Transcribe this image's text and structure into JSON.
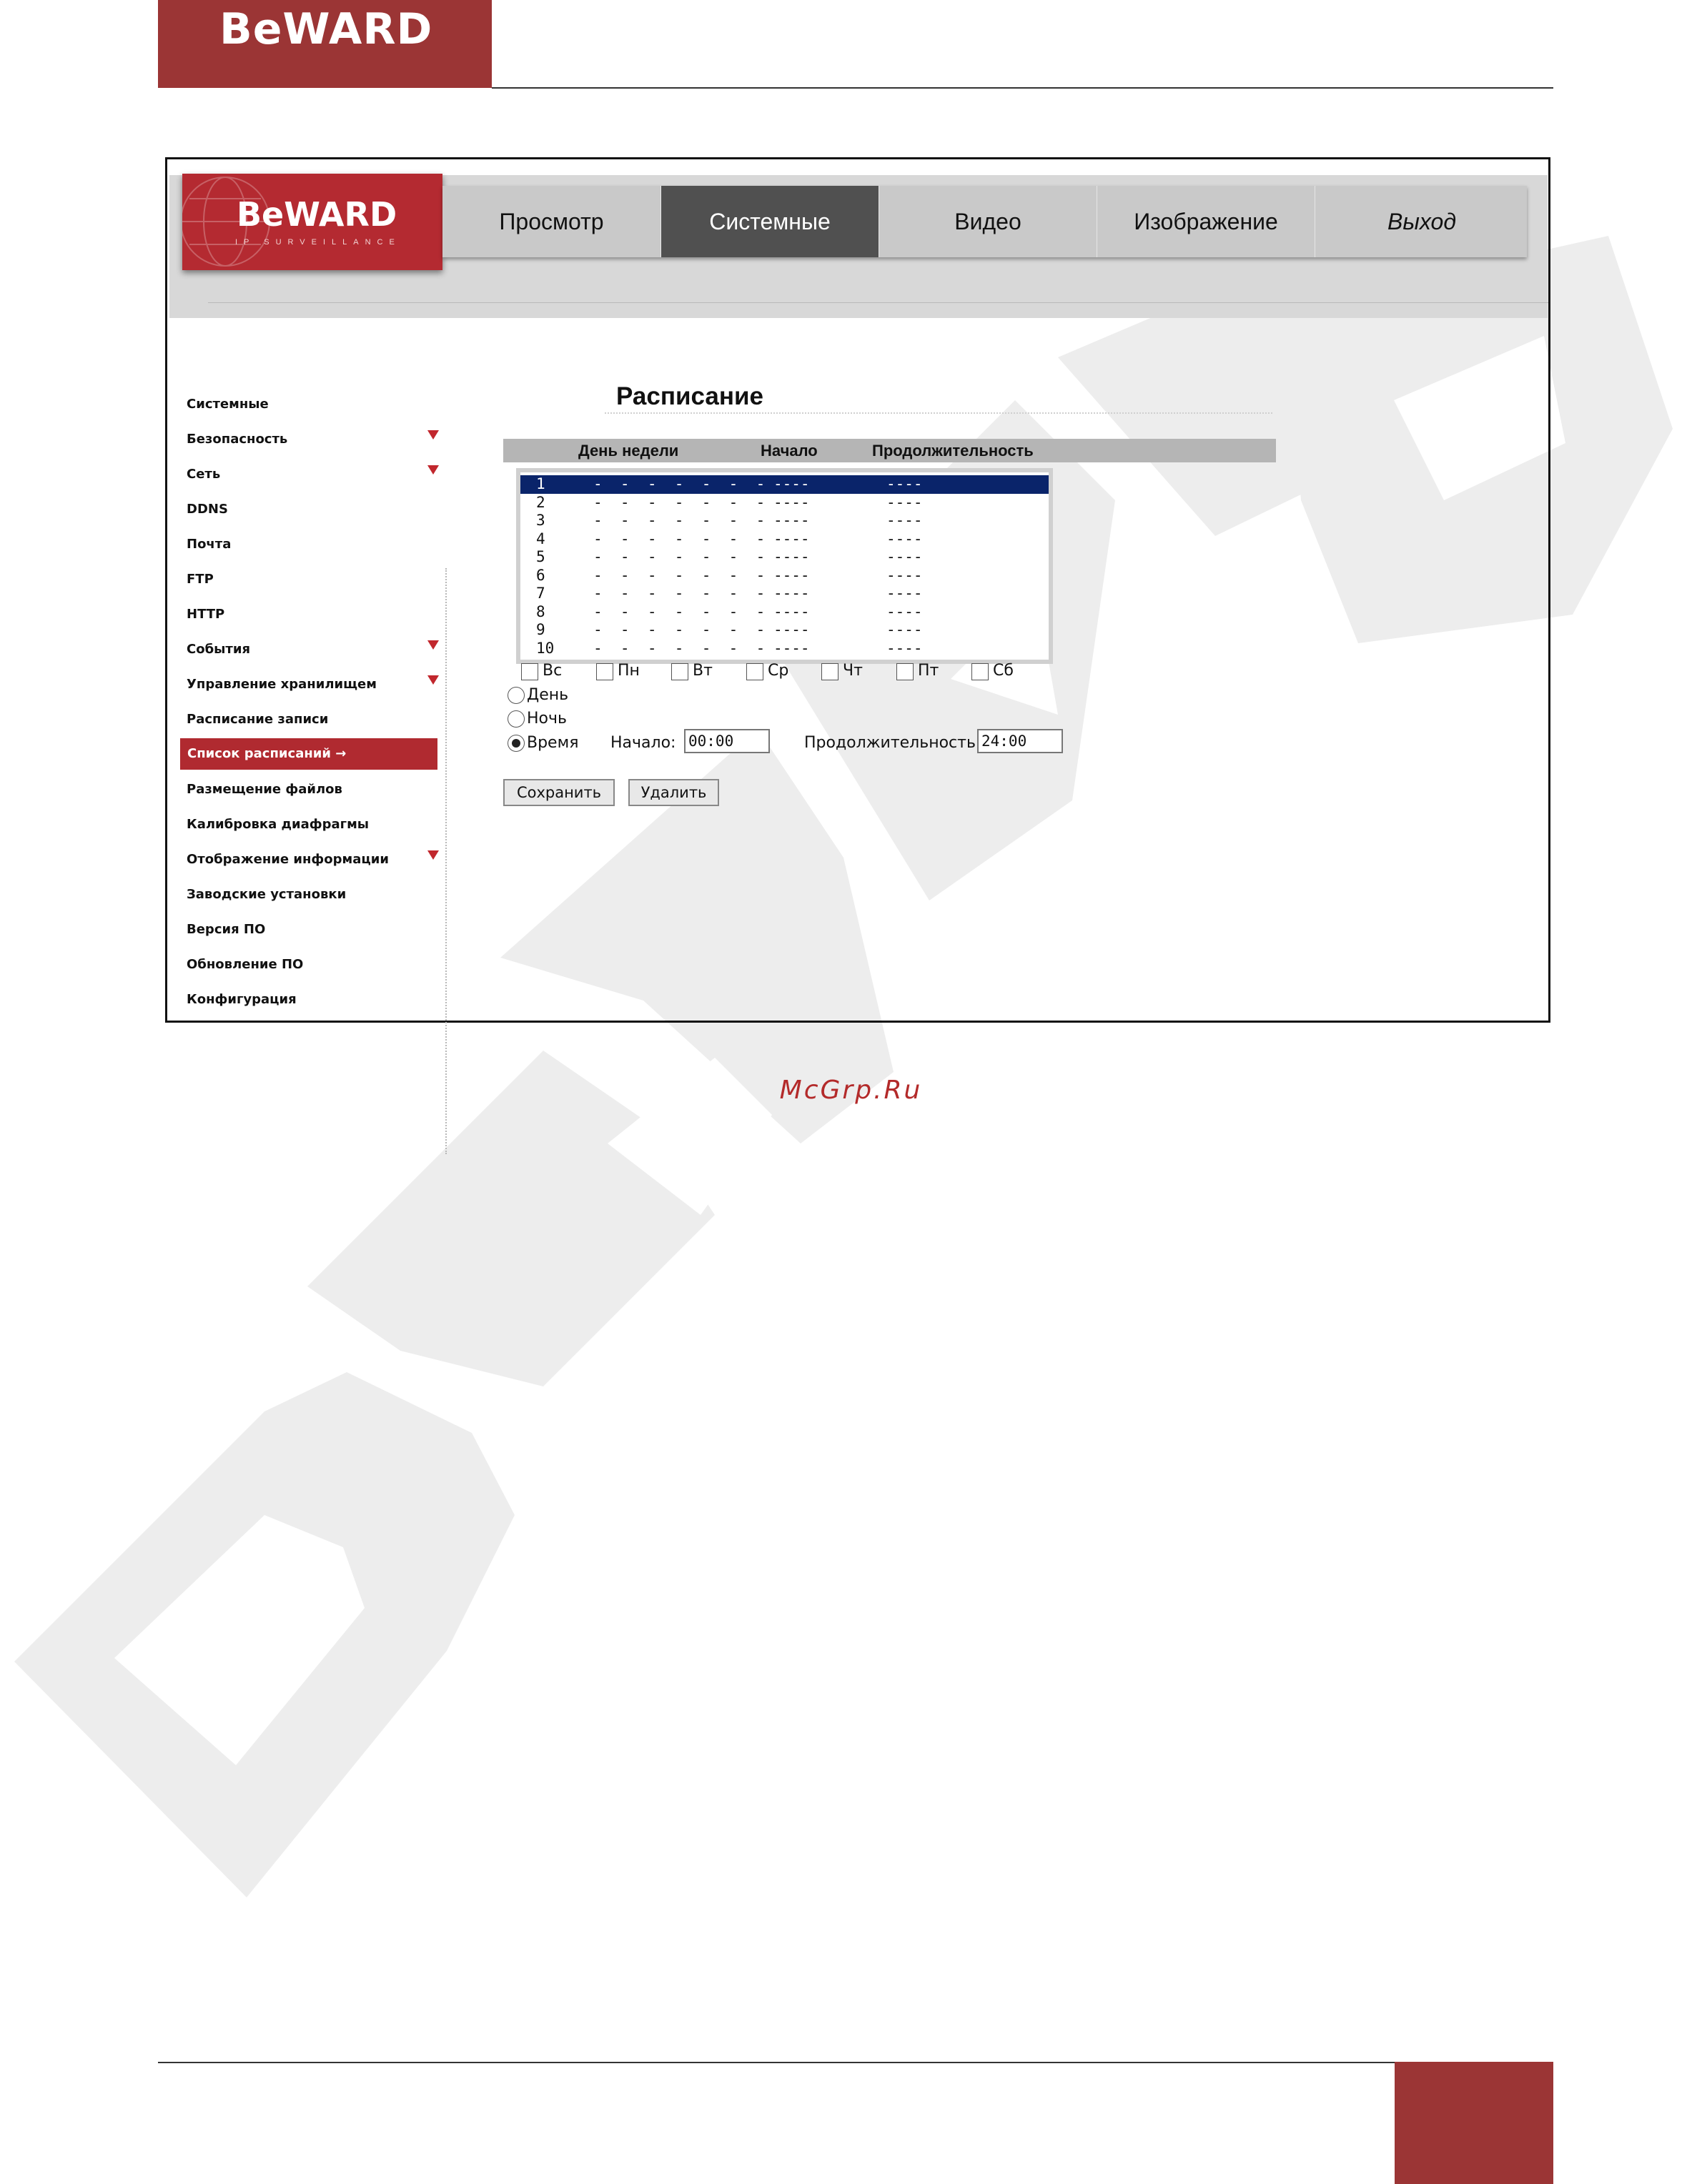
{
  "document": {
    "logo_text": "BeWARD",
    "footer_site": "McGrp.Ru"
  },
  "app": {
    "logo_text": "BeWARD",
    "logo_subtitle": "IP SURVEILLANCE",
    "nav": [
      {
        "label": "Просмотр",
        "active": false
      },
      {
        "label": "Системные",
        "active": true
      },
      {
        "label": "Видео",
        "active": false
      },
      {
        "label": "Изображение",
        "active": false
      },
      {
        "label": "Выход",
        "active": false
      }
    ]
  },
  "sidebar": {
    "items": [
      {
        "label": "Системные",
        "has_arrow": false
      },
      {
        "label": "Безопасность",
        "has_arrow": true
      },
      {
        "label": "Сеть",
        "has_arrow": true
      },
      {
        "label": "DDNS",
        "has_arrow": false
      },
      {
        "label": "Почта",
        "has_arrow": false
      },
      {
        "label": "FTP",
        "has_arrow": false
      },
      {
        "label": "HTTP",
        "has_arrow": false
      },
      {
        "label": "События",
        "has_arrow": true
      },
      {
        "label": "Управление хранилищем",
        "has_arrow": true
      },
      {
        "label": "Расписание записи",
        "has_arrow": false
      },
      {
        "label": "Список расписаний",
        "has_arrow": false,
        "active": true,
        "suffix": "→"
      },
      {
        "label": "Размещение файлов",
        "has_arrow": false
      },
      {
        "label": "Калибровка диафрагмы",
        "has_arrow": false
      },
      {
        "label": "Отображение информации",
        "has_arrow": true
      },
      {
        "label": "Заводские установки",
        "has_arrow": false
      },
      {
        "label": "Версия ПО",
        "has_arrow": false
      },
      {
        "label": "Обновление ПО",
        "has_arrow": false
      },
      {
        "label": "Конфигурация",
        "has_arrow": false
      }
    ]
  },
  "schedule": {
    "title": "Расписание",
    "columns": {
      "day": "День недели",
      "start": "Начало",
      "duration": "Продолжительность"
    },
    "rows": [
      {
        "num": "1",
        "days": "-  -  -  -  -  -  -",
        "start": "----",
        "duration": "----",
        "selected": true
      },
      {
        "num": "2",
        "days": "-  -  -  -  -  -  -",
        "start": "----",
        "duration": "----"
      },
      {
        "num": "3",
        "days": "-  -  -  -  -  -  -",
        "start": "----",
        "duration": "----"
      },
      {
        "num": "4",
        "days": "-  -  -  -  -  -  -",
        "start": "----",
        "duration": "----"
      },
      {
        "num": "5",
        "days": "-  -  -  -  -  -  -",
        "start": "----",
        "duration": "----"
      },
      {
        "num": "6",
        "days": "-  -  -  -  -  -  -",
        "start": "----",
        "duration": "----"
      },
      {
        "num": "7",
        "days": "-  -  -  -  -  -  -",
        "start": "----",
        "duration": "----"
      },
      {
        "num": "8",
        "days": "-  -  -  -  -  -  -",
        "start": "----",
        "duration": "----"
      },
      {
        "num": "9",
        "days": "-  -  -  -  -  -  -",
        "start": "----",
        "duration": "----"
      },
      {
        "num": "10",
        "days": "-  -  -  -  -  -  -",
        "start": "----",
        "duration": "----"
      }
    ],
    "weekdays": [
      {
        "label": "Вс",
        "checked": false
      },
      {
        "label": "Пн",
        "checked": false
      },
      {
        "label": "Вт",
        "checked": false
      },
      {
        "label": "Ср",
        "checked": false
      },
      {
        "label": "Чт",
        "checked": false
      },
      {
        "label": "Пт",
        "checked": false
      },
      {
        "label": "Сб",
        "checked": false
      }
    ],
    "modes": [
      {
        "label": "День",
        "selected": false
      },
      {
        "label": "Ночь",
        "selected": false
      },
      {
        "label": "Время",
        "selected": true
      }
    ],
    "start_label": "Начало:",
    "start_value": "00:00",
    "duration_label": "Продолжительность:",
    "duration_value": "24:00",
    "save_label": "Сохранить",
    "delete_label": "Удалить"
  },
  "colors": {
    "brand_red": "#9b3535",
    "nav_active": "#505050",
    "sidebar_active": "#b02a30",
    "list_selection": "#0a246a"
  }
}
